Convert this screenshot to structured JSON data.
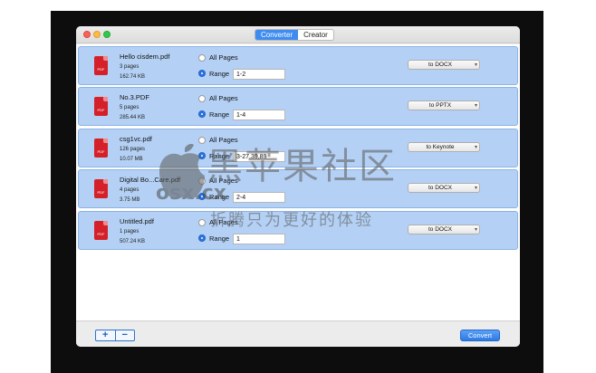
{
  "window": {
    "tabs": [
      {
        "label": "Converter",
        "active": true
      },
      {
        "label": "Creator",
        "active": false
      }
    ]
  },
  "file_icon_label": "PDF",
  "radio_labels": {
    "all_pages": "All Pages",
    "range": "Range"
  },
  "files": [
    {
      "name": "Hello cisdem.pdf",
      "pages": "3 pages",
      "size": "162.74 KB",
      "selected_option": "range",
      "range": "1-2",
      "format": "to DOCX"
    },
    {
      "name": "No.3.PDF",
      "pages": "5 pages",
      "size": "285.44 KB",
      "selected_option": "range",
      "range": "1-4",
      "format": "to PPTX"
    },
    {
      "name": "csg1vc.pdf",
      "pages": "126 pages",
      "size": "10.07 MB",
      "selected_option": "range",
      "range": "3-27,39,89",
      "format": "to Keynote"
    },
    {
      "name": "Digital Bo...Care.pdf",
      "pages": "4 pages",
      "size": "3.75 MB",
      "selected_option": "range",
      "range": "2-4",
      "format": "to DOCX"
    },
    {
      "name": "Untitled.pdf",
      "pages": "1 pages",
      "size": "507.24 KB",
      "selected_option": "range",
      "range": "1",
      "format": "to DOCX"
    }
  ],
  "bottom": {
    "add_label": "+",
    "remove_label": "−",
    "convert_label": "Convert"
  },
  "watermark": {
    "title": "黑苹果社区",
    "domain": "osx.cx",
    "slogan": "折腾只为更好的体验"
  },
  "colors": {
    "accent": "#3f8cf0",
    "row_bg": "#b4d1f5",
    "pdf_red": "#d42028"
  }
}
